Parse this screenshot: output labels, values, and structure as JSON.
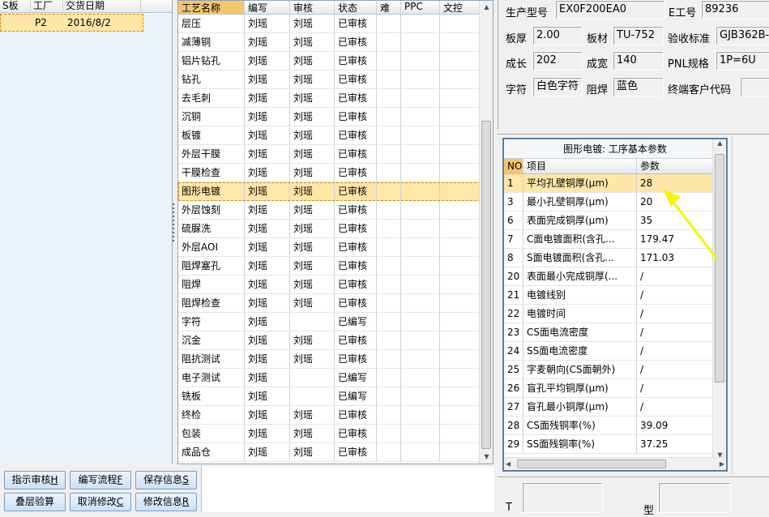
{
  "left": {
    "headers": [
      "S板",
      "工厂",
      "交货日期"
    ],
    "row": {
      "factory": "P2",
      "date": "2016/8/2"
    }
  },
  "process": {
    "headers": [
      "工艺名称",
      "编写",
      "审核",
      "状态",
      "难",
      "PPC",
      "文控"
    ],
    "rows": [
      [
        "层压",
        "刘瑶",
        "刘瑶",
        "已审核"
      ],
      [
        "减薄铜",
        "刘瑶",
        "刘瑶",
        "已审核"
      ],
      [
        "铝片钻孔",
        "刘瑶",
        "刘瑶",
        "已审核"
      ],
      [
        "钻孔",
        "刘瑶",
        "刘瑶",
        "已审核"
      ],
      [
        "去毛刺",
        "刘瑶",
        "刘瑶",
        "已审核"
      ],
      [
        "沉铜",
        "刘瑶",
        "刘瑶",
        "已审核"
      ],
      [
        "板镀",
        "刘瑶",
        "刘瑶",
        "已审核"
      ],
      [
        "外层干膜",
        "刘瑶",
        "刘瑶",
        "已审核"
      ],
      [
        "干膜检查",
        "刘瑶",
        "刘瑶",
        "已审核"
      ],
      [
        "图形电镀",
        "刘瑶",
        "刘瑶",
        "已审核"
      ],
      [
        "外层蚀刻",
        "刘瑶",
        "刘瑶",
        "已审核"
      ],
      [
        "硫脲洗",
        "刘瑶",
        "刘瑶",
        "已审核"
      ],
      [
        "外层AOI",
        "刘瑶",
        "刘瑶",
        "已审核"
      ],
      [
        "阻焊塞孔",
        "刘瑶",
        "刘瑶",
        "已审核"
      ],
      [
        "阻焊",
        "刘瑶",
        "刘瑶",
        "已审核"
      ],
      [
        "阻焊检查",
        "刘瑶",
        "刘瑶",
        "已审核"
      ],
      [
        "字符",
        "刘瑶",
        "",
        "已编写"
      ],
      [
        "沉金",
        "刘瑶",
        "刘瑶",
        "已审核"
      ],
      [
        "阻抗测试",
        "刘瑶",
        "刘瑶",
        "已审核"
      ],
      [
        "电子测试",
        "刘瑶",
        "",
        "已编写"
      ],
      [
        "铣板",
        "刘瑶",
        "",
        "已编写"
      ],
      [
        "终检",
        "刘瑶",
        "刘瑶",
        "已审核"
      ],
      [
        "包装",
        "刘瑶",
        "刘瑶",
        "已审核"
      ],
      [
        "成品仓",
        "刘瑶",
        "刘瑶",
        "已审核"
      ]
    ],
    "selected_index": 9
  },
  "buttons": [
    {
      "label": "指示审核",
      "key": "H"
    },
    {
      "label": "编写流程",
      "key": "F"
    },
    {
      "label": "保存信息",
      "key": "S"
    },
    {
      "label": "叠层验算",
      "key": ""
    },
    {
      "label": "取消修改",
      "key": "C"
    },
    {
      "label": "修改信息",
      "key": "R"
    }
  ],
  "info": {
    "prod_model_label": "生产型号",
    "prod_model": "EX0F200EA0",
    "e_no_label": "E工号",
    "e_no": "89236",
    "thickness_label": "板厚",
    "thickness": "2.00",
    "material_label": "板材",
    "material": "TU-752",
    "std_label": "验收标准",
    "std": "GJB362B-",
    "length_label": "成长",
    "length": "202",
    "width_label": "成宽",
    "width": "140",
    "pnl_label": "PNL规格",
    "pnl": "1P=6U",
    "char_label": "字符",
    "char": "白色字符",
    "mask_label": "阻焊",
    "mask": "蓝色",
    "customer_label": "终端客户代码",
    "customer": ""
  },
  "params": {
    "title": "图形电镀: 工序基本参数",
    "headers": [
      "NO",
      "项目",
      "参数"
    ],
    "rows": [
      [
        "1",
        "平均孔壁铜厚(μm)",
        "28"
      ],
      [
        "3",
        "最小孔壁铜厚(μm)",
        "20"
      ],
      [
        "6",
        "表面完成铜厚(μm)",
        "35"
      ],
      [
        "7",
        "C面电镀面积(含孔...",
        "179.47"
      ],
      [
        "8",
        "S面电镀面积(含孔...",
        "171.03"
      ],
      [
        "20",
        "表面最小完成铜厚(...",
        "/"
      ],
      [
        "21",
        "电镀线别",
        "/"
      ],
      [
        "22",
        "电镀时间",
        "/"
      ],
      [
        "23",
        "CS面电流密度",
        "/"
      ],
      [
        "24",
        "SS面电流密度",
        "/"
      ],
      [
        "25",
        "字麦朝向(CS面朝外)",
        "/"
      ],
      [
        "26",
        "盲孔平均铜厚(μm)",
        "/"
      ],
      [
        "27",
        "盲孔最小铜厚(μm)",
        "/"
      ],
      [
        "28",
        "CS面残铜率(%)",
        "39.09"
      ],
      [
        "29",
        "SS面残铜率(%)",
        "37.25"
      ]
    ]
  },
  "bottom": {
    "label1": "T",
    "label2": "型"
  },
  "colors": {
    "selection": "#ffe7a8",
    "header_accent": "#f5c56d",
    "arrow": "#f5f500"
  }
}
